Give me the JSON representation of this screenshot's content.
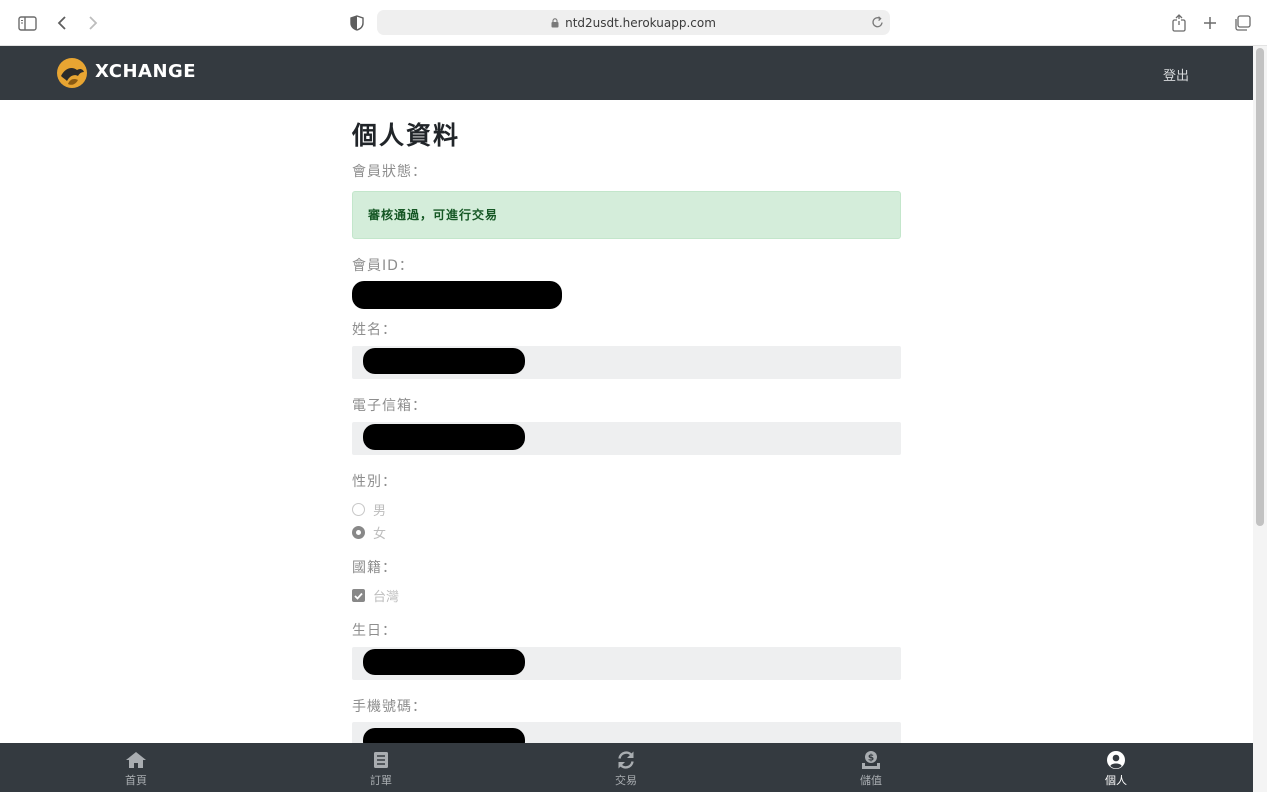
{
  "browser": {
    "url": "ntd2usdt.herokuapp.com"
  },
  "navbar": {
    "brand": "XCHANGE",
    "logout_label": "登出",
    "logo_colors": {
      "outer": "#e8a532",
      "inner": "#2b2b2b"
    }
  },
  "profile": {
    "title": "個人資料",
    "status_label": "會員狀態：",
    "status_message": "審核通過，可進行交易",
    "member_id_label": "會員ID：",
    "name_label": "姓名：",
    "email_label": "電子信箱：",
    "gender_label": "性別：",
    "gender_options": [
      "男",
      "女"
    ],
    "gender_selected": "女",
    "nationality_label": "國籍：",
    "nationality_option": "台灣",
    "nationality_checked": true,
    "birthday_label": "生日：",
    "phone_label": "手機號碼："
  },
  "tabbar": {
    "tabs": [
      {
        "label": "首頁",
        "icon": "home-icon"
      },
      {
        "label": "訂單",
        "icon": "list-icon"
      },
      {
        "label": "交易",
        "icon": "sync-icon"
      },
      {
        "label": "儲值",
        "icon": "deposit-icon"
      },
      {
        "label": "個人",
        "icon": "user-circle-icon"
      }
    ],
    "active": "個人"
  },
  "colors": {
    "navbar_bg": "#343a40",
    "alert_bg": "#d4edda",
    "alert_text": "#155724"
  }
}
